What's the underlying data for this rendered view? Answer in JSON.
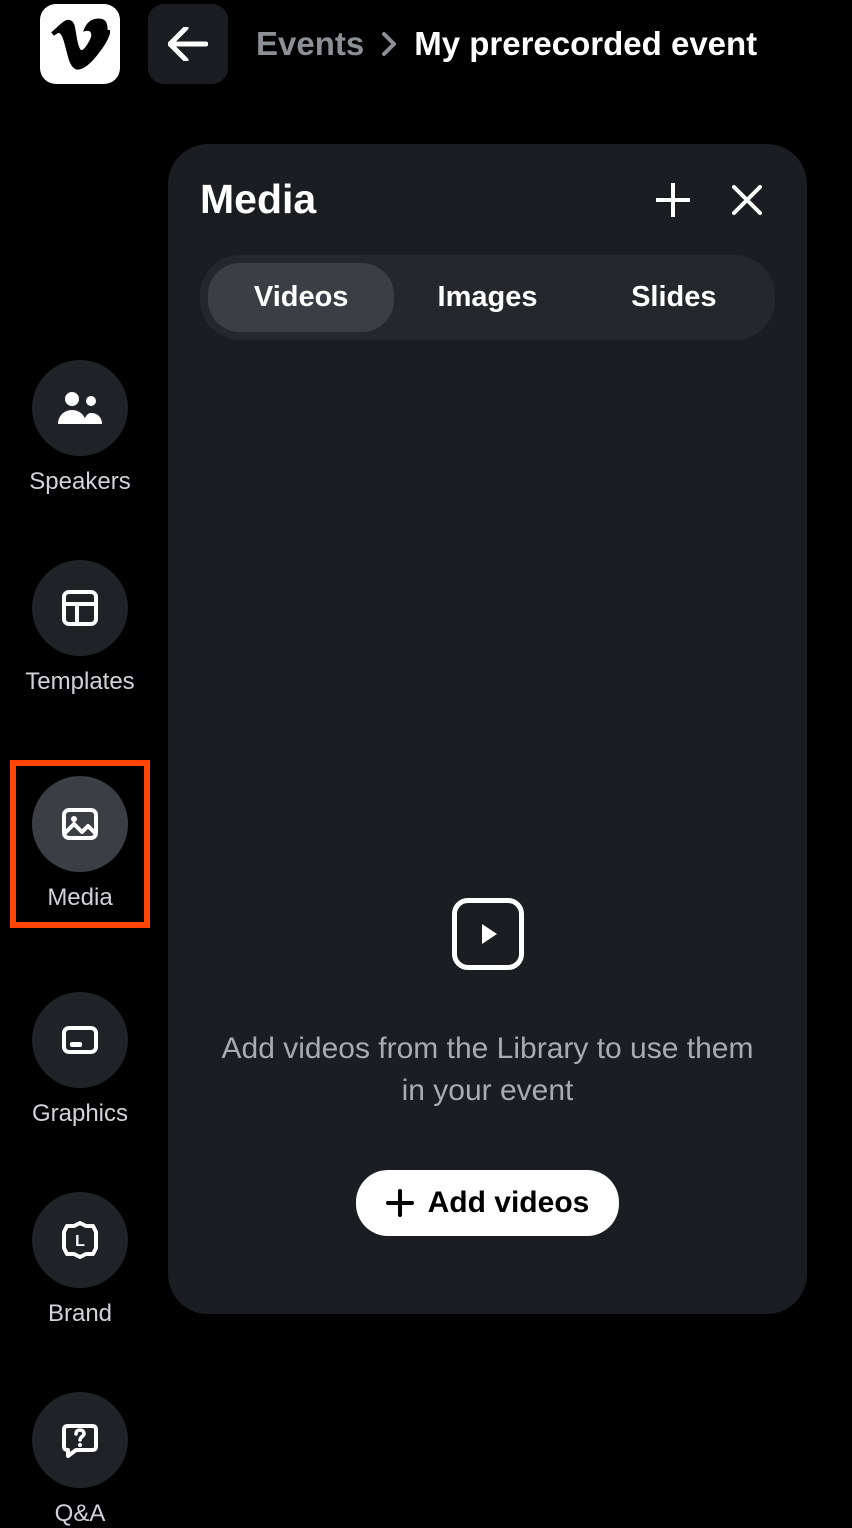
{
  "breadcrumb": {
    "parent": "Events",
    "current": "My prerecorded event"
  },
  "sidebar": {
    "items": [
      {
        "label": "Speakers",
        "icon": "speakers",
        "active": false,
        "highlighted": false
      },
      {
        "label": "Templates",
        "icon": "templates",
        "active": false,
        "highlighted": false
      },
      {
        "label": "Media",
        "icon": "media",
        "active": true,
        "highlighted": true
      },
      {
        "label": "Graphics",
        "icon": "graphics",
        "active": false,
        "highlighted": false
      },
      {
        "label": "Brand",
        "icon": "brand",
        "active": false,
        "highlighted": false
      },
      {
        "label": "Q&A",
        "icon": "qa",
        "active": false,
        "highlighted": false
      }
    ]
  },
  "panel": {
    "title": "Media",
    "tabs": [
      {
        "label": "Videos",
        "active": true
      },
      {
        "label": "Images",
        "active": false
      },
      {
        "label": "Slides",
        "active": false
      }
    ],
    "empty_text": "Add videos from the Library to use them in your event",
    "add_button": "Add videos"
  }
}
